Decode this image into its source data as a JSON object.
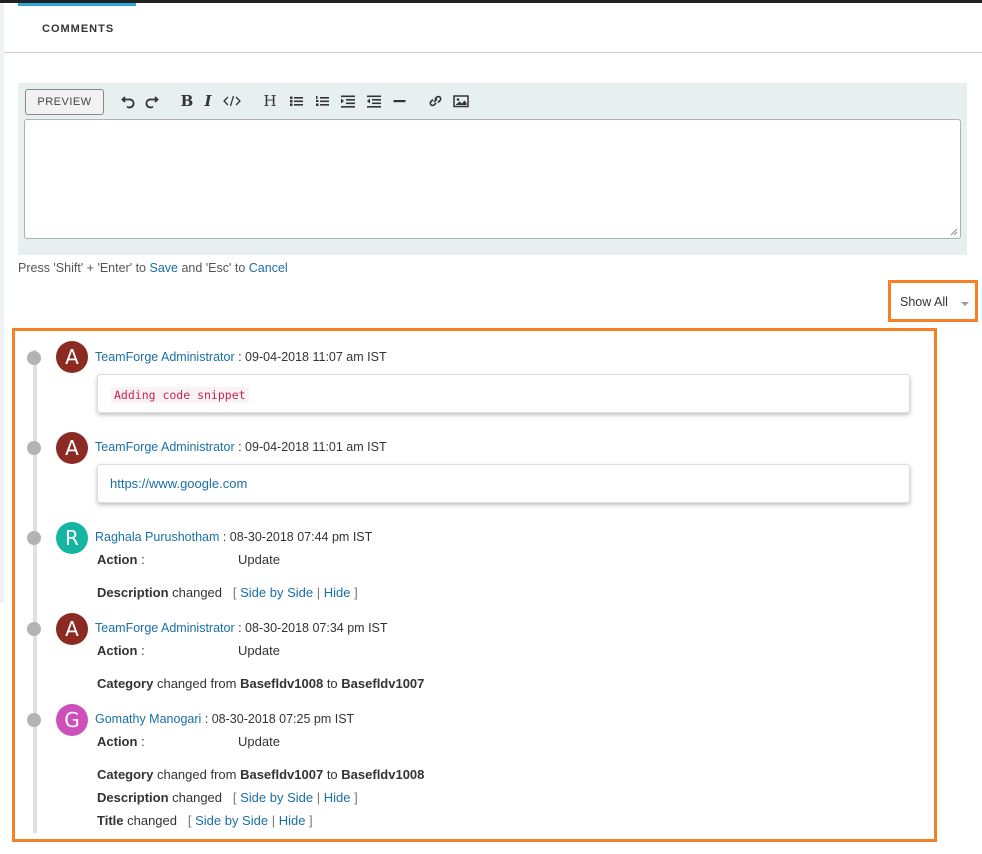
{
  "tabs": {
    "comments": "COMMENTS"
  },
  "editor": {
    "preview_label": "PREVIEW",
    "toolbar": [
      "undo-icon",
      "redo-icon",
      "bold-icon",
      "italic-icon",
      "code-icon",
      "heading-icon",
      "bullet-list-icon",
      "numbered-list-icon",
      "indent-icon",
      "outdent-icon",
      "horizontal-rule-icon",
      "link-icon",
      "image-icon"
    ]
  },
  "hint": {
    "prefix": "Press 'Shift' + 'Enter' to ",
    "save": "Save",
    "middle": " and 'Esc' to ",
    "cancel": "Cancel"
  },
  "filter": {
    "selected": "Show All"
  },
  "entries": [
    {
      "avatar_letter": "A",
      "avatar_color": "#8b2b23",
      "author": "TeamForge Administrator",
      "timestamp": " : 09-04-2018 11:07 am IST",
      "comment_code": "Adding code snippet"
    },
    {
      "avatar_letter": "A",
      "avatar_color": "#8b2b23",
      "author": "TeamForge Administrator",
      "timestamp": " : 09-04-2018 11:01 am IST",
      "comment_link": "https://www.google.com"
    },
    {
      "avatar_letter": "R",
      "avatar_color": "#16b5a1",
      "author": "Raghala Purushotham",
      "timestamp": " : 08-30-2018 07:44 pm IST",
      "action_label": "Action",
      "action_colon": " :",
      "action_value": "Update",
      "field": "Description",
      "changed": " changed",
      "side_by_side": "Side by Side",
      "hide": "Hide"
    },
    {
      "avatar_letter": "A",
      "avatar_color": "#8b2b23",
      "author": "TeamForge Administrator",
      "timestamp": " : 08-30-2018 07:34 pm IST",
      "action_label": "Action",
      "action_colon": " :",
      "action_value": "Update",
      "field": "Category",
      "changed_from": " changed from ",
      "from": "Basefldv1008",
      "to_word": " to ",
      "to": "Basefldv1007"
    },
    {
      "avatar_letter": "G",
      "avatar_color": "#cf4fba",
      "author": "Gomathy Manogari",
      "timestamp": " : 08-30-2018 07:25 pm IST",
      "action_label": "Action",
      "action_colon": " :",
      "action_value": "Update",
      "changes": [
        {
          "field": "Category",
          "changed_from": " changed from ",
          "from": "Basefldv1007",
          "to_word": " to ",
          "to": "Basefldv1008"
        },
        {
          "field": "Description",
          "changed": " changed",
          "side_by_side": "Side by Side",
          "hide": "Hide"
        },
        {
          "field": "Title",
          "changed": " changed",
          "side_by_side": "Side by Side",
          "hide": "Hide"
        }
      ]
    }
  ],
  "labels": {
    "open_bracket": "[ ",
    "pipe": " | ",
    "close_bracket": " ]"
  }
}
